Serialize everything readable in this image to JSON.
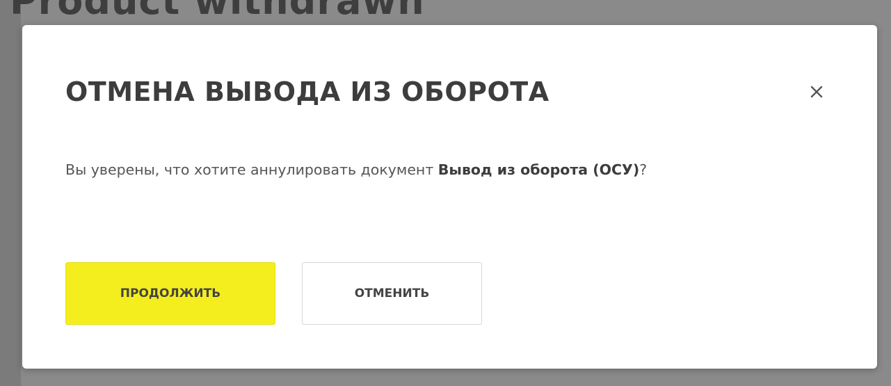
{
  "background": {
    "heading": "Product withdrawn",
    "overlay_color": "#8a8a8a"
  },
  "modal": {
    "title": "ОТМЕНА ВЫВОДА ИЗ ОБОРОТА",
    "close_icon": "close-icon",
    "message_prefix": "Вы уверены, что хотите аннулировать документ ",
    "document_name": "Вывод из оборота (ОСУ)",
    "message_suffix": "?",
    "continue_label": "ПРОДОЛЖИТЬ",
    "cancel_label": "ОТМЕНИТЬ",
    "accent_color": "#f5ee1e"
  }
}
